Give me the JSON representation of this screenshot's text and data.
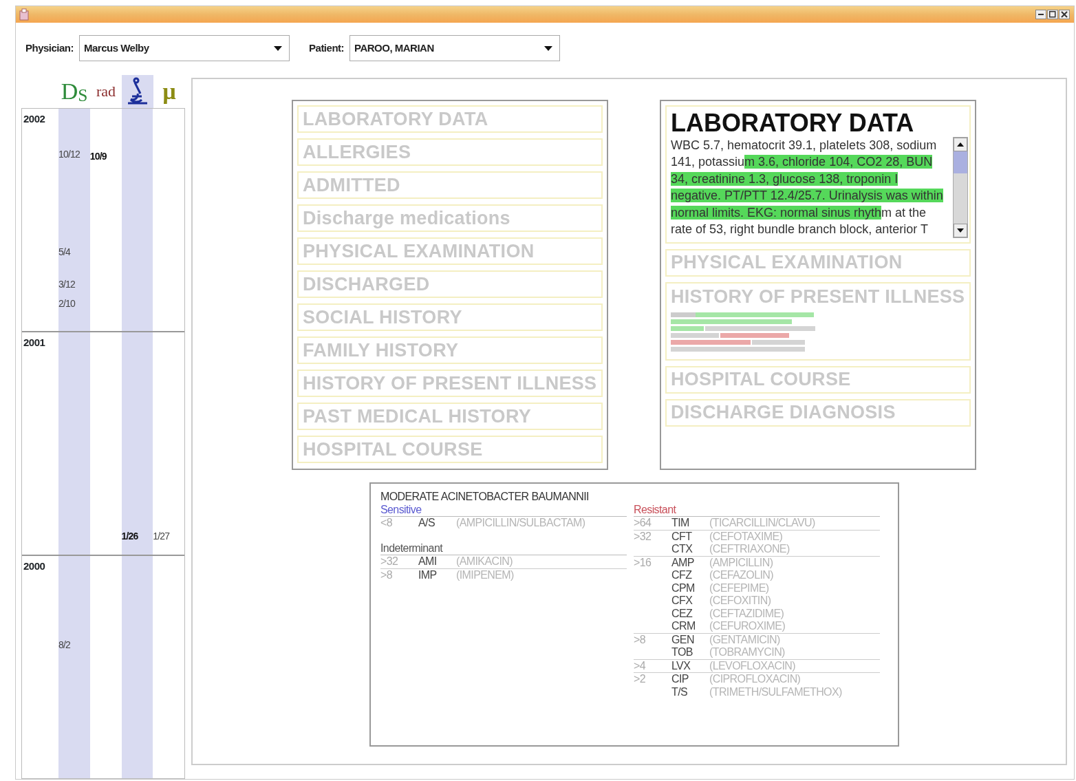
{
  "toolbar": {
    "physician": {
      "label": "Physician:",
      "value": "Marcus Welby"
    },
    "patient": {
      "label": "Patient:",
      "value": "PAROO, MARIAN"
    }
  },
  "timeline": {
    "columns": [
      {
        "kind": "text",
        "label": "D$_{S}$",
        "color": "#2e8b3a",
        "selected": false
      },
      {
        "kind": "text",
        "label": "rad",
        "color": "#8b2d2d",
        "selected": false
      },
      {
        "kind": "icon",
        "selected": true
      },
      {
        "kind": "text",
        "label": "µ",
        "color": "#8c8c14",
        "selected": false
      }
    ],
    "years": [
      {
        "year": "2002",
        "events": [
          {
            "kind": "summary",
            "label": "10/12",
            "selected": false
          },
          {
            "kind": "radiology",
            "label": "10/9",
            "selected": true
          },
          {
            "kind": "summary",
            "label": "5/4",
            "selected": false
          },
          {
            "kind": "summary",
            "label": "3/12",
            "selected": false
          },
          {
            "kind": "summary",
            "label": "2/10",
            "selected": false
          }
        ]
      },
      {
        "year": "2001",
        "events": [
          {
            "kind": "lab",
            "label": "1/26",
            "selected": true
          },
          {
            "kind": "micro",
            "label": "1/27",
            "selected": false
          }
        ]
      },
      {
        "year": "2000",
        "events": [
          {
            "kind": "summary",
            "label": "8/2",
            "selected": false
          }
        ]
      }
    ]
  },
  "outline": {
    "sections": [
      {
        "title": "LABORATORY DATA"
      },
      {
        "title": "ALLERGIES"
      },
      {
        "title": "ADMITTED"
      },
      {
        "title": "Discharge medications"
      },
      {
        "title": "PHYSICAL EXAMINATION"
      },
      {
        "title": "DISCHARGED"
      },
      {
        "title": "SOCIAL HISTORY"
      },
      {
        "title": "FAMILY HISTORY"
      },
      {
        "title": "HISTORY OF PRESENT ILLNESS"
      },
      {
        "title": "PAST MEDICAL HISTORY"
      },
      {
        "title": "HOSPITAL COURSE"
      }
    ]
  },
  "note": {
    "sections": [
      {
        "kind": "open",
        "title": "LABORATORY DATA",
        "text": [
          {
            "text": "WBC 5.7, hematocrit 39.1, platelets 308, sodium 141, potassiu",
            "highlighted": false
          },
          {
            "text": "m 3.6, chloride 104, CO2 28, BUN 34, creatinine 1.3, glucose 138, troponin I negative. PT/PTT 12.4/25.7. Urinalysis was within normal limits. EKG: normal sinus rhyth",
            "highlighted": true
          },
          {
            "text": "m at the rate of 53, right bundle branch block, anterior T",
            "highlighted": false
          }
        ]
      },
      {
        "kind": "closed",
        "title": "PHYSICAL EXAMINATION"
      },
      {
        "kind": "preview",
        "title": "HISTORY OF PRESENT ILLNESS"
      },
      {
        "kind": "closed",
        "title": "HOSPITAL COURSE"
      },
      {
        "kind": "closed",
        "title": "DISCHARGE DIAGNOSIS"
      }
    ]
  },
  "microbiology": {
    "organism": "MODERATE ACINETOBACTER BAUMANNII",
    "columns": [
      [
        {
          "label": "Sensitive",
          "color": "#5a5ad0",
          "rows": [
            {
              "mic": "<8",
              "drugs": [
                {
                  "code": "A/S",
                  "name": "(AMPICILLIN/SULBACTAM)"
                }
              ]
            }
          ]
        },
        {
          "label": "Indeterminant",
          "color": "#555555",
          "rows": [
            {
              "mic": ">32",
              "drugs": [
                {
                  "code": "AMI",
                  "name": "(AMIKACIN)"
                }
              ]
            },
            {
              "mic": ">8",
              "drugs": [
                {
                  "code": "IMP",
                  "name": "(IMIPENEM)"
                }
              ]
            }
          ]
        }
      ],
      [
        {
          "label": "Resistant",
          "color": "#c8505a",
          "rows": [
            {
              "mic": ">64",
              "drugs": [
                {
                  "code": "TIM",
                  "name": "(TICARCILLIN/CLAVU)"
                }
              ]
            },
            {
              "mic": ">32",
              "drugs": [
                {
                  "code": "CFT",
                  "name": "(CEFOTAXIME)"
                },
                {
                  "code": "CTX",
                  "name": "(CEFTRIAXONE)"
                }
              ]
            },
            {
              "mic": ">16",
              "drugs": [
                {
                  "code": "AMP",
                  "name": "(AMPICILLIN)"
                },
                {
                  "code": "CFZ",
                  "name": "(CEFAZOLIN)"
                },
                {
                  "code": "CPM",
                  "name": "(CEFEPIME)"
                },
                {
                  "code": "CFX",
                  "name": "(CEFOXITIN)"
                },
                {
                  "code": "CEZ",
                  "name": "(CEFTAZIDIME)"
                },
                {
                  "code": "CRM",
                  "name": "(CEFUROXIME)"
                }
              ]
            },
            {
              "mic": ">8",
              "drugs": [
                {
                  "code": "GEN",
                  "name": "(GENTAMICIN)"
                },
                {
                  "code": "TOB",
                  "name": "(TOBRAMYCIN)"
                }
              ]
            },
            {
              "mic": ">4",
              "drugs": [
                {
                  "code": "LVX",
                  "name": "(LEVOFLOXACIN)"
                }
              ]
            },
            {
              "mic": ">2",
              "drugs": [
                {
                  "code": "CIP",
                  "name": "(CIPROFLOXACIN)"
                },
                {
                  "code": "T/S",
                  "name": "(TRIMETH/SULFAMETHOX)"
                }
              ]
            }
          ]
        }
      ]
    ]
  }
}
